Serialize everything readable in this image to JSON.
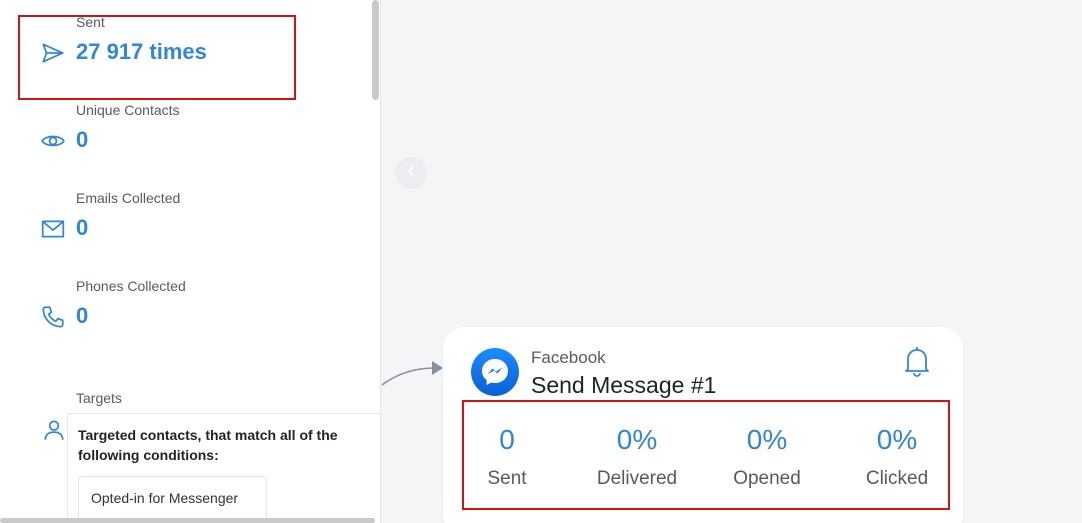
{
  "sidebar": {
    "stats": [
      {
        "label": "Sent",
        "value": "27 917 times",
        "icon": "send-icon"
      },
      {
        "label": "Unique Contacts",
        "value": "0",
        "icon": "eye-icon"
      },
      {
        "label": "Emails Collected",
        "value": "0",
        "icon": "mail-icon"
      },
      {
        "label": "Phones Collected",
        "value": "0",
        "icon": "phone-icon"
      }
    ],
    "targets": {
      "label": "Targets",
      "icon": "user-icon",
      "description": "Targeted contacts, that match all of the following conditions:",
      "conditions": [
        "Opted-in for Messenger"
      ]
    }
  },
  "node": {
    "platform": "Facebook",
    "title": "Send Message #1",
    "platform_icon": "messenger-icon",
    "action_icon": "bell-icon",
    "metrics": [
      {
        "value": "0",
        "label": "Sent"
      },
      {
        "value": "0%",
        "label": "Delivered"
      },
      {
        "value": "0%",
        "label": "Opened"
      },
      {
        "value": "0%",
        "label": "Clicked"
      }
    ]
  },
  "colors": {
    "accent": "#2f86dc",
    "highlight": "#d01414",
    "messenger_gradient_start": "#1a8cff",
    "messenger_gradient_end": "#0a5fd6"
  }
}
